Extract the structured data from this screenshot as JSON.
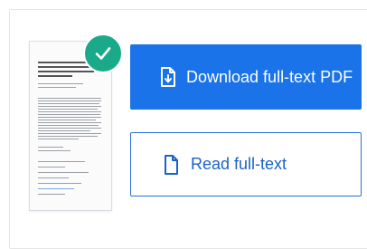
{
  "actions": {
    "download_label": "Download full-text PDF",
    "read_label": "Read full-text"
  },
  "status": {
    "icon": "checkmark-icon",
    "color": "#1aaa8a"
  },
  "colors": {
    "primary": "#1a73e8",
    "secondary_text": "#1a62c6"
  },
  "icons": {
    "download": "pdf-download-icon",
    "document": "document-icon"
  }
}
